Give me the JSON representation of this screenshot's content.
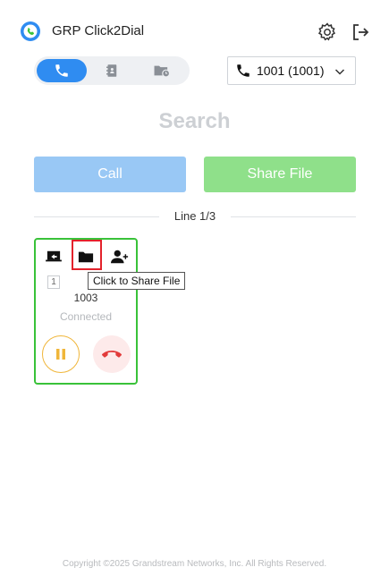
{
  "app": {
    "title": "GRP Click2Dial"
  },
  "mode_tabs": [
    {
      "icon": "phone-icon",
      "active": true
    },
    {
      "icon": "contacts-book-icon",
      "active": false
    },
    {
      "icon": "call-history-icon",
      "active": false
    }
  ],
  "account": {
    "label": "1001 (1001)"
  },
  "search": {
    "placeholder": "Search"
  },
  "actions": {
    "call_label": "Call",
    "share_label": "Share File"
  },
  "lines": {
    "label": "Line 1/3"
  },
  "line_card": {
    "line_number": "1",
    "extension": "1003",
    "status": "Connected",
    "tooltip": "Click to Share File"
  },
  "footer": {
    "copyright": "Copyright ©2025 Grandstream Networks, Inc. All Rights Reserved."
  },
  "colors": {
    "accent": "#2f8cf1",
    "call_button": "#99c8f5",
    "share_button": "#8fe08a",
    "card_border": "#39c239",
    "highlight": "#e3222b",
    "hold": "#f0b63a",
    "hangup": "#e23b3b"
  }
}
